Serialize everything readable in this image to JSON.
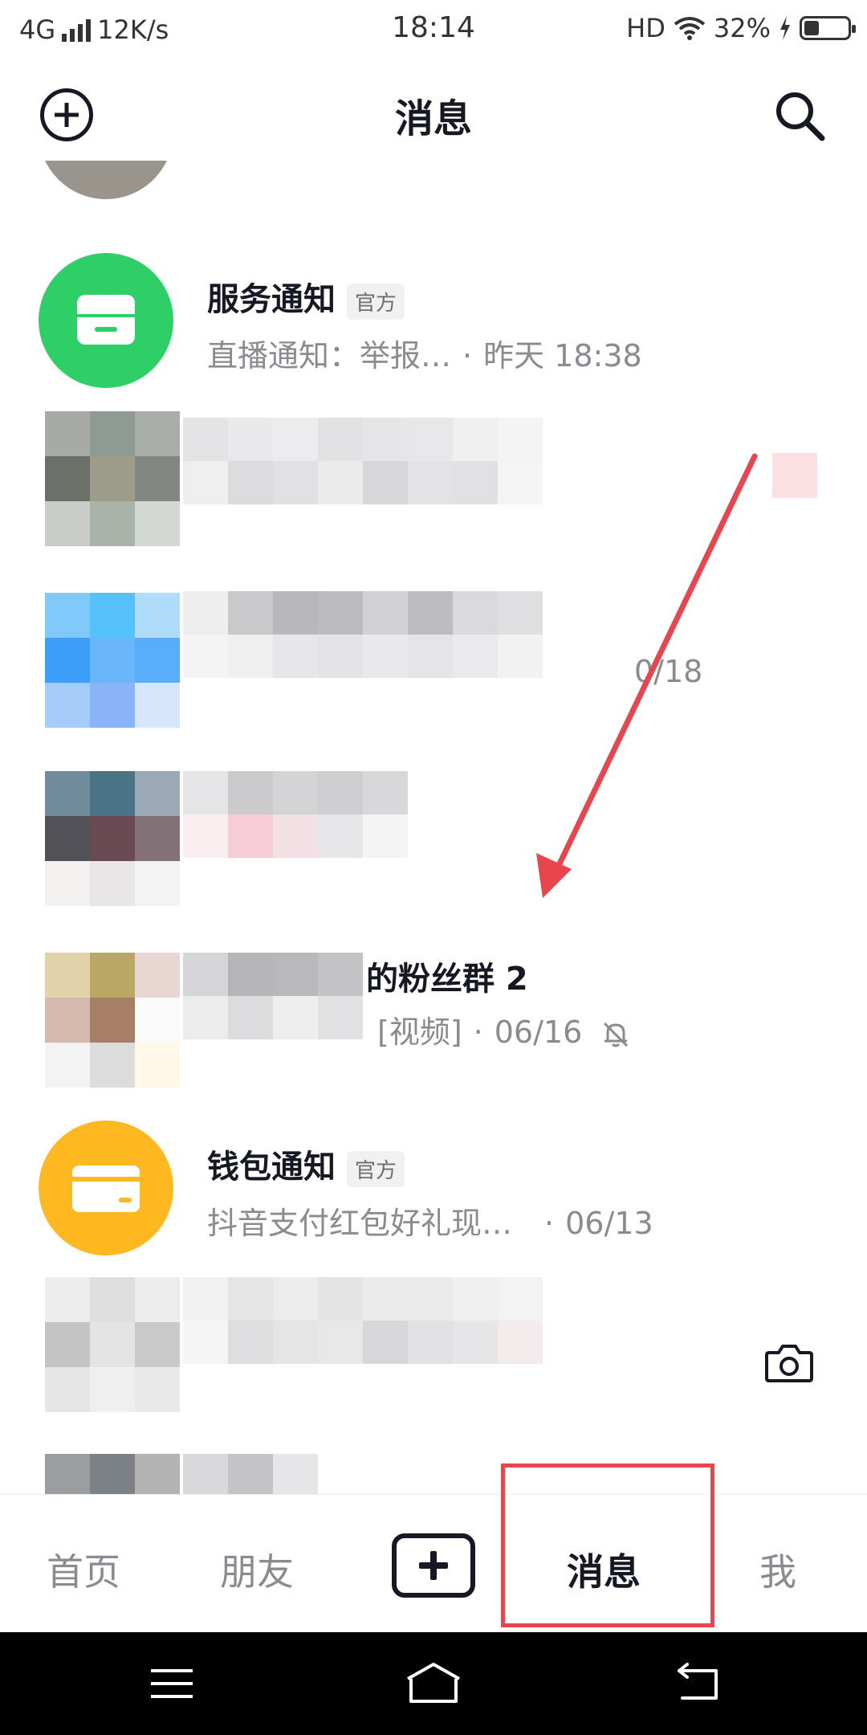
{
  "status_bar": {
    "network": "4G",
    "speed": "12K/s",
    "time": "18:14",
    "hd": "HD",
    "battery": "32%",
    "battery_level": 0.32
  },
  "header": {
    "title": "消息"
  },
  "messages": [
    {
      "title": "服务通知",
      "badge": "官方",
      "preview": "直播通知：举报…",
      "time": "昨天 18:38",
      "avatar_color": "#2fcf68"
    },
    {
      "title": "的粉丝群 2",
      "preview": "[视频]",
      "time": "06/16",
      "muted": true
    },
    {
      "title": "钱包通知",
      "badge": "官方",
      "preview": "抖音支付红包好礼现…",
      "time": "06/13",
      "avatar_color": "#ffb81f"
    },
    {
      "partial_time": "0/18"
    }
  ],
  "bottom_nav": {
    "tabs": [
      "首页",
      "朋友",
      "消息",
      "我"
    ],
    "active_tab": "消息"
  },
  "colors": {
    "highlight": "#e8464c",
    "arrow": "#e8464c"
  }
}
